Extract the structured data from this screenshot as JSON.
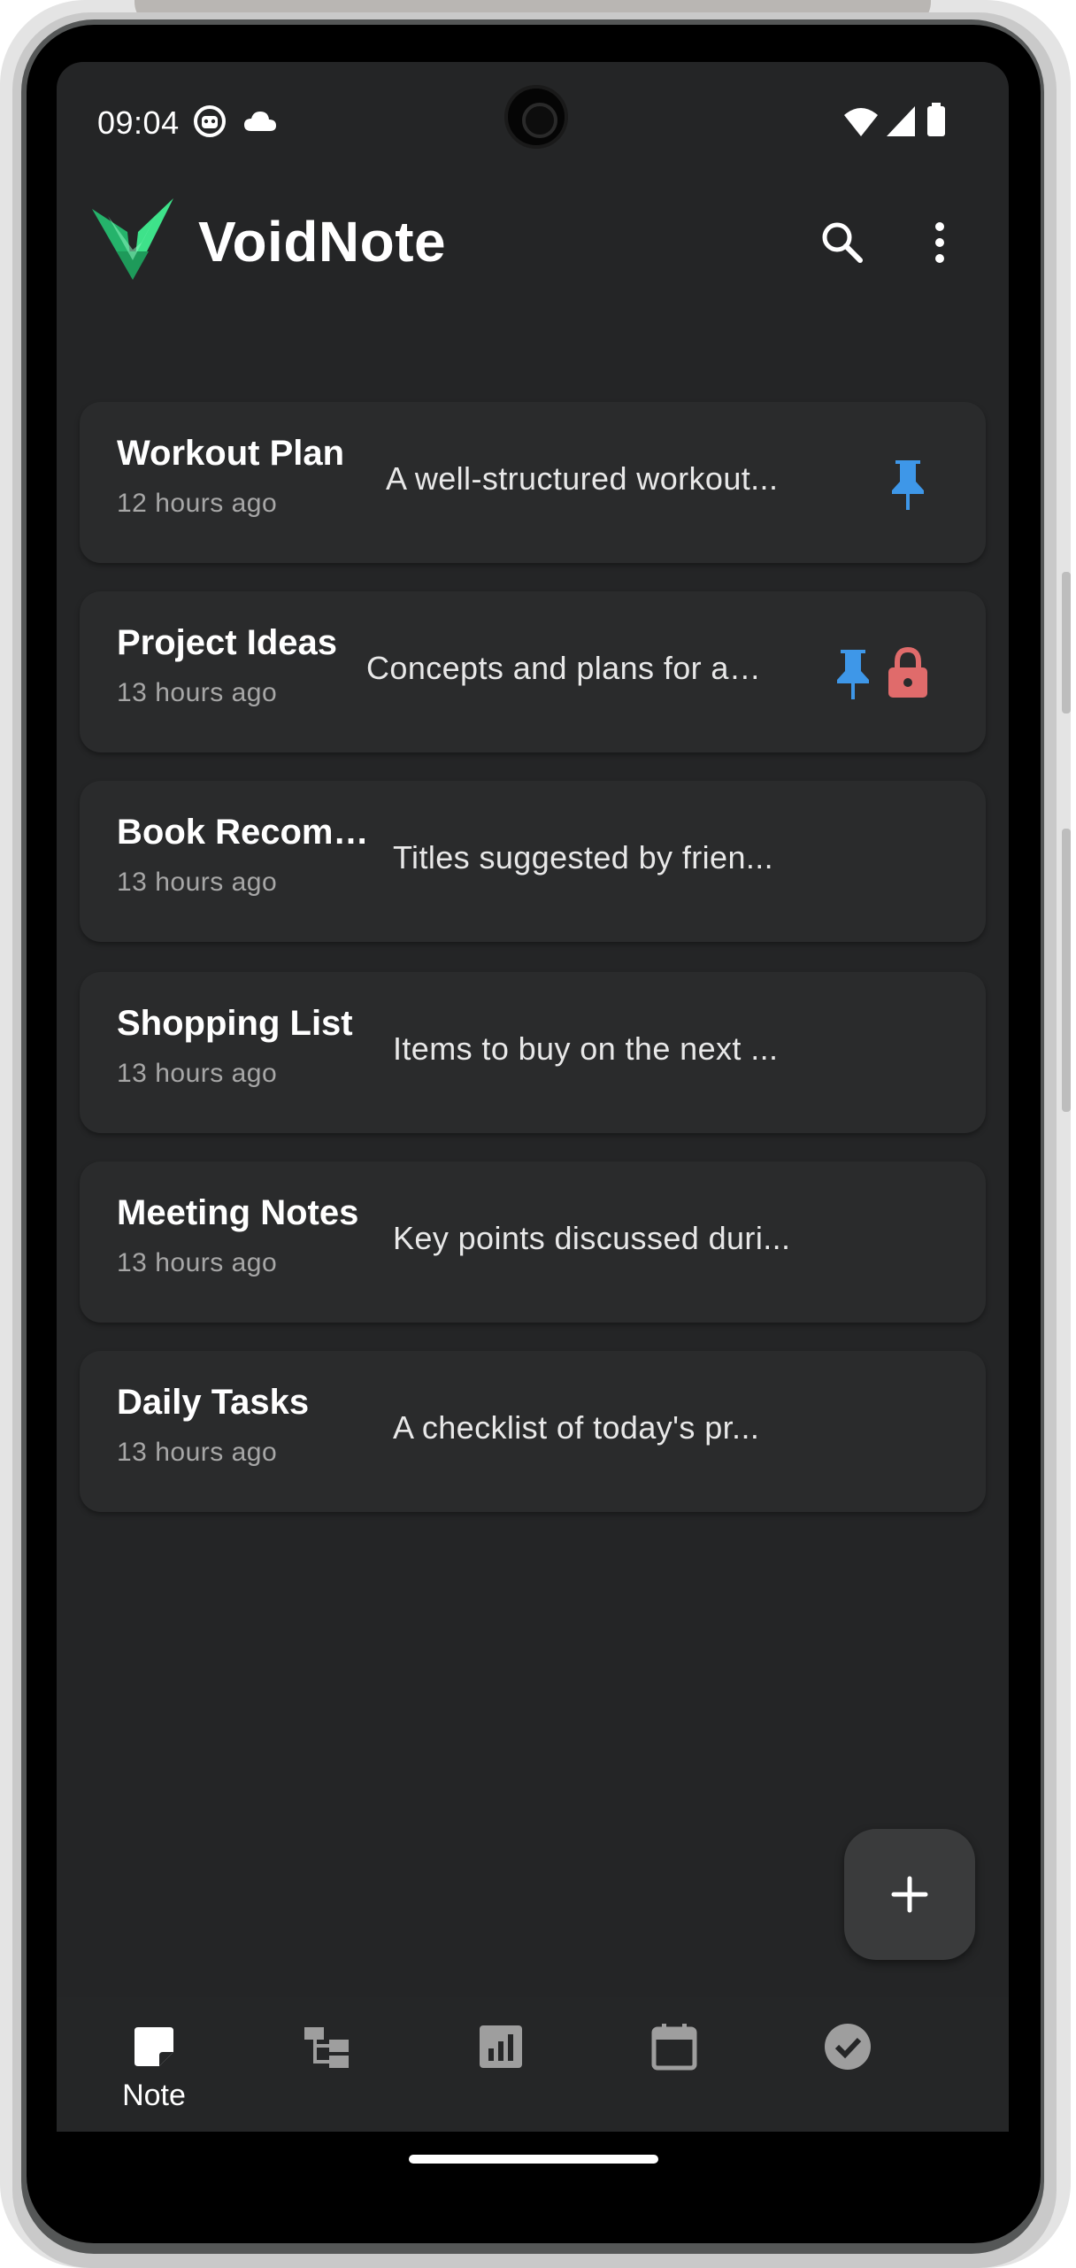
{
  "status_bar": {
    "time": "09:04",
    "left_icons": [
      "ghost-icon",
      "cloud-icon"
    ],
    "right_icons": [
      "wifi-icon",
      "signal-icon",
      "battery-icon"
    ]
  },
  "app_bar": {
    "title": "VoidNote",
    "logo_color": "#2ecc71",
    "actions": [
      "search-icon",
      "more-vert-icon"
    ]
  },
  "notes": [
    {
      "title": "Workout Plan",
      "time": "12 hours ago",
      "preview": "A well-structured workout...",
      "pinned": true,
      "locked": false
    },
    {
      "title": "Project Ideas",
      "time": "13 hours ago",
      "preview": "Concepts and plans for a…",
      "pinned": true,
      "locked": true
    },
    {
      "title": "Book Recom…",
      "time": "13 hours ago",
      "preview": "Titles suggested by frien...",
      "pinned": false,
      "locked": false
    },
    {
      "title": "Shopping List",
      "time": "13 hours ago",
      "preview": "Items to buy on the next ...",
      "pinned": false,
      "locked": false
    },
    {
      "title": "Meeting Notes",
      "time": "13 hours ago",
      "preview": "Key points discussed duri...",
      "pinned": false,
      "locked": false
    },
    {
      "title": "Daily Tasks",
      "time": "13 hours ago",
      "preview": "A checklist of today's pr...",
      "pinned": false,
      "locked": false
    }
  ],
  "colors": {
    "background": "#242526",
    "card": "#2a2b2c",
    "pin": "#3e97e8",
    "lock": "#e06b6b",
    "nav_inactive": "#9e9e9e"
  },
  "fab": {
    "icon": "plus-icon"
  },
  "bottom_nav": {
    "items": [
      {
        "icon": "note-icon",
        "label": "Note",
        "active": true
      },
      {
        "icon": "hierarchy-icon",
        "label": "",
        "active": false
      },
      {
        "icon": "chart-icon",
        "label": "",
        "active": false
      },
      {
        "icon": "calendar-icon",
        "label": "",
        "active": false
      },
      {
        "icon": "check-circle-icon",
        "label": "",
        "active": false
      }
    ]
  }
}
